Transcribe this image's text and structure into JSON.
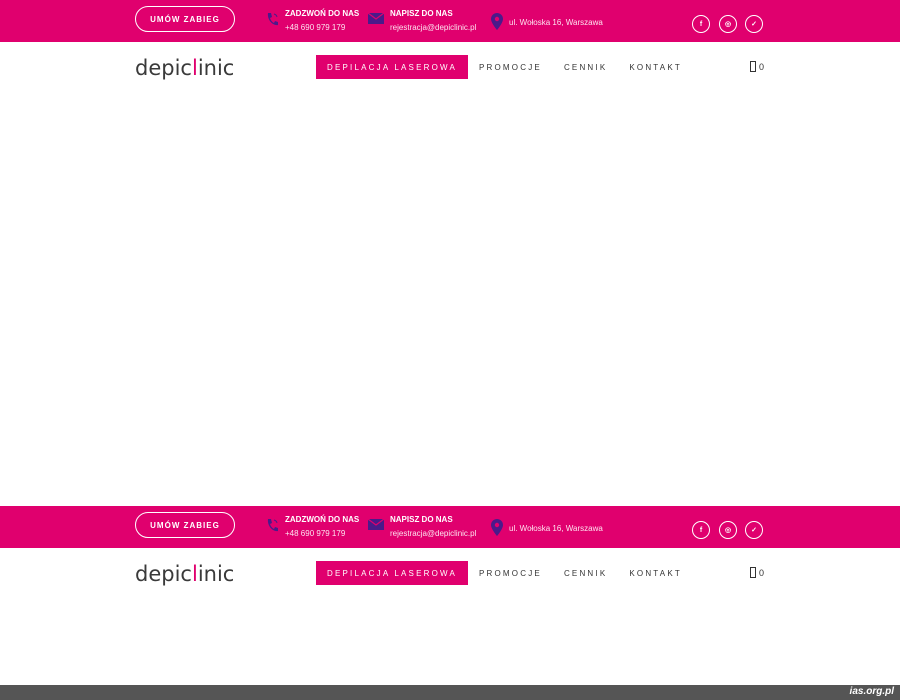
{
  "topbar": {
    "book_button": "UMÓW ZABIEG",
    "phone": {
      "label": "ZADZWOŃ DO NAS",
      "value": "+48 690 979 179",
      "icon": "phone-icon"
    },
    "email": {
      "label": "NAPISZ DO NAS",
      "value": "rejestracja@depiclinic.pl",
      "icon": "envelope-icon"
    },
    "address": {
      "value": "ul. Wołoska 16, Warszawa",
      "icon": "map-pin-icon"
    },
    "social": [
      {
        "icon": "facebook-icon",
        "glyph": "f"
      },
      {
        "icon": "instagram-icon",
        "glyph": "◎"
      },
      {
        "icon": "twitter-icon",
        "glyph": "✓"
      }
    ]
  },
  "navbar": {
    "logo_part1": "depic",
    "logo_accent": "l",
    "logo_part2": "inic",
    "items": [
      {
        "label": "DEPILACJA LASEROWA",
        "active": true
      },
      {
        "label": "PROMOCJE",
        "active": false
      },
      {
        "label": "CENNIK",
        "active": false
      },
      {
        "label": "KONTAKT",
        "active": false
      }
    ],
    "cart_count": "0"
  },
  "watermark": "ias.org.pl",
  "colors": {
    "brand": "#e0006e",
    "footer": "#555555"
  }
}
